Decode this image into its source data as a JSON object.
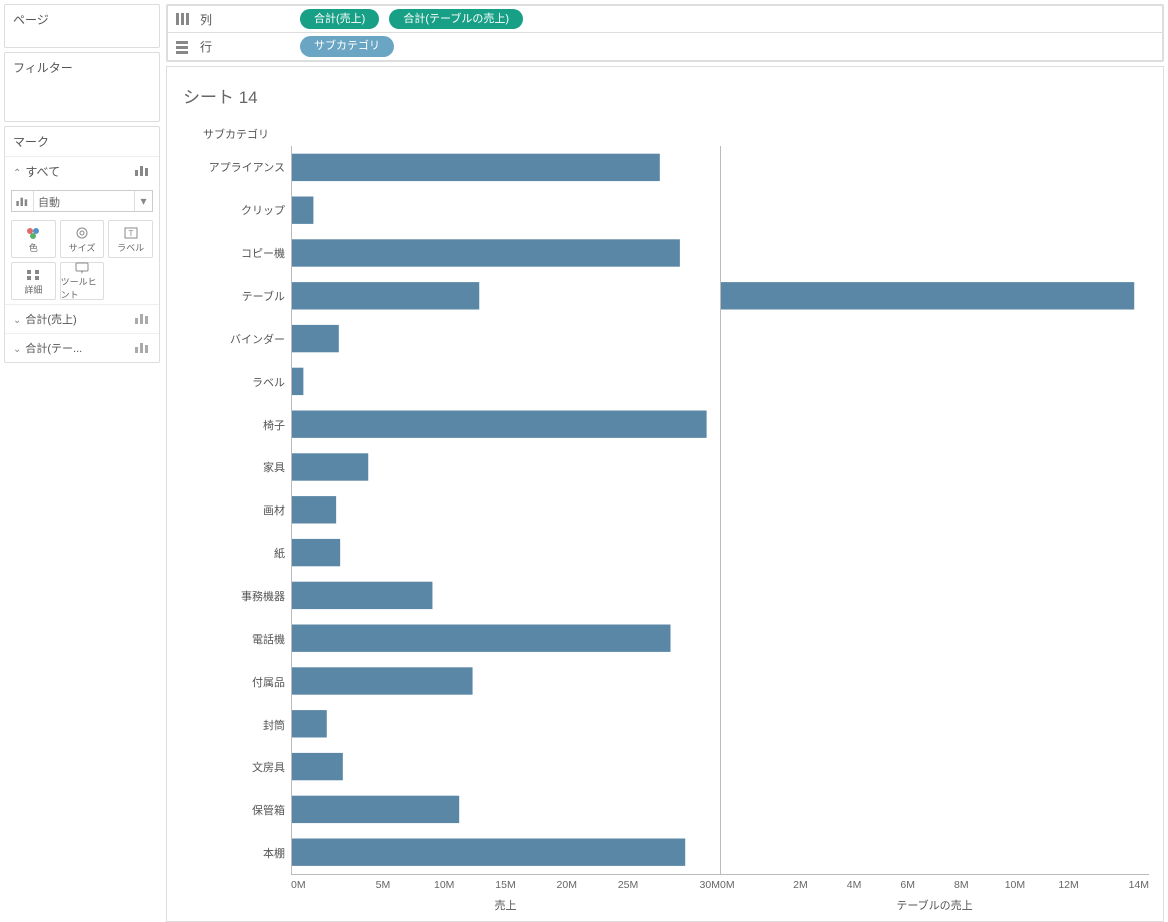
{
  "sidebar": {
    "pages_label": "ページ",
    "filters_label": "フィルター",
    "marks_label": "マーク",
    "all_label": "すべて",
    "mark_type_label": "自動",
    "buttons": {
      "color": "色",
      "size": "サイズ",
      "label": "ラベル",
      "detail": "詳細",
      "tooltip": "ツールヒント"
    },
    "measure_rows": {
      "m1": "合計(売上)",
      "m2": "合計(テー..."
    }
  },
  "shelves": {
    "columns_label": "列",
    "rows_label": "行",
    "col_pills": {
      "p1": "合計(売上)",
      "p2": "合計(テーブルの売上)"
    },
    "row_pills": {
      "p1": "サブカテゴリ"
    }
  },
  "sheet_title": "シート 14",
  "chart_data": {
    "type": "bar",
    "orientation": "horizontal",
    "column_header": "サブカテゴリ",
    "categories": [
      "アプライアンス",
      "クリップ",
      "コピー機",
      "テーブル",
      "バインダー",
      "ラベル",
      "椅子",
      "家具",
      "画材",
      "紙",
      "事務機器",
      "電話機",
      "付属品",
      "封筒",
      "文房具",
      "保管箱",
      "本棚"
    ],
    "series": [
      {
        "name": "売上",
        "axis_label": "売上",
        "xlim": [
          0,
          32000000
        ],
        "ticks": [
          "0M",
          "5M",
          "10M",
          "15M",
          "20M",
          "25M",
          "30M"
        ],
        "values": [
          27500000,
          1600000,
          29000000,
          14000000,
          3500000,
          850000,
          31000000,
          5700000,
          3300000,
          3600000,
          10500000,
          28300000,
          13500000,
          2600000,
          3800000,
          12500000,
          29400000
        ]
      },
      {
        "name": "テーブルの売上",
        "axis_label": "テーブルの売上",
        "xlim": [
          0,
          14500000
        ],
        "ticks": [
          "0M",
          "2M",
          "4M",
          "6M",
          "8M",
          "10M",
          "12M",
          "14M"
        ],
        "values": [
          0,
          0,
          0,
          14000000,
          0,
          0,
          0,
          0,
          0,
          0,
          0,
          0,
          0,
          0,
          0,
          0,
          0
        ]
      }
    ],
    "bar_color": "#5b87a6"
  }
}
